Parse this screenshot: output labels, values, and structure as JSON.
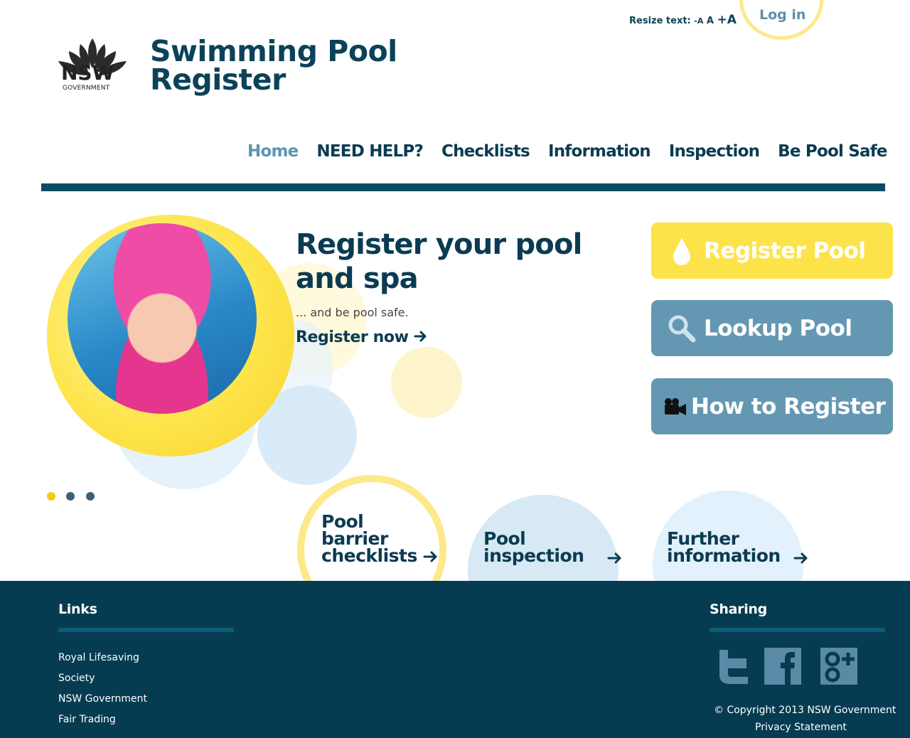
{
  "header": {
    "logo_line1": "NSW",
    "logo_line2": "GOVERNMENT",
    "title_line1": "Swimming Pool",
    "title_line2": "Register",
    "resize_label": "Resize text:",
    "resize_small": "-A",
    "resize_normal": "A",
    "resize_large": "+A",
    "login": "Log in"
  },
  "nav": {
    "items": [
      "Home",
      "NEED HELP?",
      "Checklists",
      "Information",
      "Inspection",
      "Be Pool Safe"
    ],
    "active": "Home"
  },
  "hero": {
    "title_line1": "Register your pool",
    "title_line2": "and spa",
    "subtitle": "... and be pool safe.",
    "link": "Register now",
    "slides": 3,
    "active_slide": 1
  },
  "actions": {
    "register": "Register Pool",
    "lookup": "Lookup Pool",
    "how": "How to Register"
  },
  "quicklinks": {
    "q1_l1": "Pool",
    "q1_l2": "barrier",
    "q1_l3": "checklists",
    "q2_l1": "Pool",
    "q2_l2": "inspection",
    "q3_l1": "Further",
    "q3_l2": "information"
  },
  "footer": {
    "links_title": "Links",
    "links": [
      "Royal Lifesaving",
      "Society",
      "NSW Government",
      "Fair Trading"
    ],
    "sharing_title": "Sharing",
    "social_icons": [
      "twitter-icon",
      "facebook-icon",
      "google-plus-icon"
    ],
    "copyright": "© Copyright 2013 NSW Government",
    "privacy": "Privacy Statement"
  },
  "colors": {
    "navy": "#0b3b52",
    "footer_bg": "#063c51",
    "yellow": "#fde34a",
    "steel_blue": "#6498b2"
  }
}
